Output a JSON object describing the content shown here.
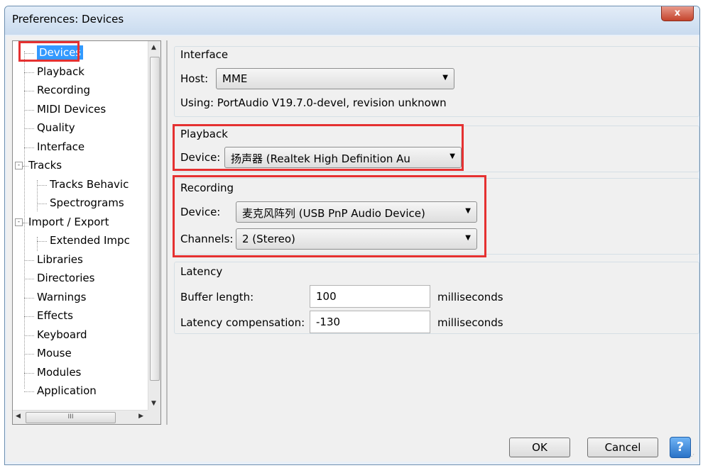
{
  "window": {
    "title": "Preferences: Devices",
    "close_label": "x"
  },
  "tree": {
    "items": [
      {
        "label": "Devices"
      },
      {
        "label": "Playback"
      },
      {
        "label": "Recording"
      },
      {
        "label": "MIDI Devices"
      },
      {
        "label": "Quality"
      },
      {
        "label": "Interface"
      },
      {
        "label": "Tracks",
        "expander": "-"
      },
      {
        "label": "Tracks Behavic"
      },
      {
        "label": "Spectrograms"
      },
      {
        "label": "Import / Export",
        "expander": "-"
      },
      {
        "label": "Extended Impc"
      },
      {
        "label": "Libraries"
      },
      {
        "label": "Directories"
      },
      {
        "label": "Warnings"
      },
      {
        "label": "Effects"
      },
      {
        "label": "Keyboard"
      },
      {
        "label": "Mouse"
      },
      {
        "label": "Modules"
      },
      {
        "label": "Application"
      }
    ],
    "selected": "Devices",
    "hscroll_thumb_label": "III"
  },
  "interface": {
    "title": "Interface",
    "host_label": "Host:",
    "host_value": "MME",
    "using_text": "Using: PortAudio V19.7.0-devel, revision unknown"
  },
  "playback": {
    "title": "Playback",
    "device_label": "Device:",
    "device_value": "扬声器 (Realtek High Definition Au"
  },
  "recording": {
    "title": "Recording",
    "device_label": "Device:",
    "device_value": "麦克风阵列 (USB PnP Audio Device)",
    "channels_label": "Channels:",
    "channels_value": "2 (Stereo)"
  },
  "latency": {
    "title": "Latency",
    "buffer_label": "Buffer length:",
    "buffer_value": "100",
    "buffer_unit": "milliseconds",
    "comp_label": "Latency compensation:",
    "comp_value": "-130",
    "comp_unit": "milliseconds"
  },
  "buttons": {
    "ok": "OK",
    "cancel": "Cancel",
    "help": "?"
  },
  "colors": {
    "highlight": "#e53131",
    "selection": "#3399ff"
  }
}
